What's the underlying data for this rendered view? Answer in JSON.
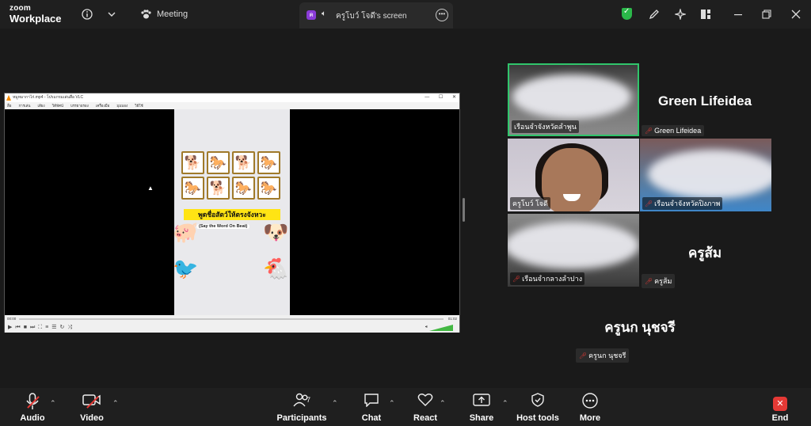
{
  "titlebar": {
    "logo_line1": "zoom",
    "logo_line2": "Workplace",
    "meeting_label": "Meeting",
    "screen_tab_badge": "ค",
    "screen_tab_label": "ครูโบว์ โจดี's screen"
  },
  "vlc": {
    "title": "หมูหมากาไก่.mp4 - โปรแกรมเล่นสื่อ VLC",
    "menu": [
      "สื่อ",
      "การเล่น",
      "เสียง",
      "วิดีทัศน์",
      "บรรยายรอง",
      "เครื่องมือ",
      "มุมมอง",
      "วิธีใช้"
    ],
    "time_elapsed": "00:00",
    "time_total": "01:02",
    "volume_percent": 100,
    "banner_text": "พูดชื่อสัตว์ให้ตรงจังหวะ",
    "sub_banner_text": "(Say the Word On Beat)",
    "card_grid": [
      "dog-icon",
      "horse-icon",
      "dog-icon",
      "horse-icon",
      "horse-icon",
      "dog-icon",
      "horse-icon",
      "horse-icon"
    ]
  },
  "participants": {
    "tile1_name": "เรือนจำจังหวัดลำพูน",
    "green_name_big": "Green Lifeidea",
    "green_name_tag": "Green Lifeidea",
    "tile2_name": "ครูโบว์ โจดี",
    "tile3_name": "เรือนจำจังหวัดปิงภาพ",
    "tile4_name": "เรือนจำกลางลำปาง",
    "som_big": "ครูส้ม",
    "som_tag": "ครูส้ม",
    "nok_big": "ครูนก นุชจรี",
    "nok_tag": "ครูนก นุชจรี"
  },
  "toolbar": {
    "audio": "Audio",
    "video": "Video",
    "participants": "Participants",
    "participants_count": "7",
    "chat": "Chat",
    "react": "React",
    "share": "Share",
    "host_tools": "Host tools",
    "more": "More",
    "end": "End"
  },
  "colors": {
    "active_speaker_border": "#30c56b",
    "muted_red": "#e53935",
    "banner_yellow": "#ffe414",
    "shield_green": "#2bb84a",
    "end_red": "#e53935"
  }
}
